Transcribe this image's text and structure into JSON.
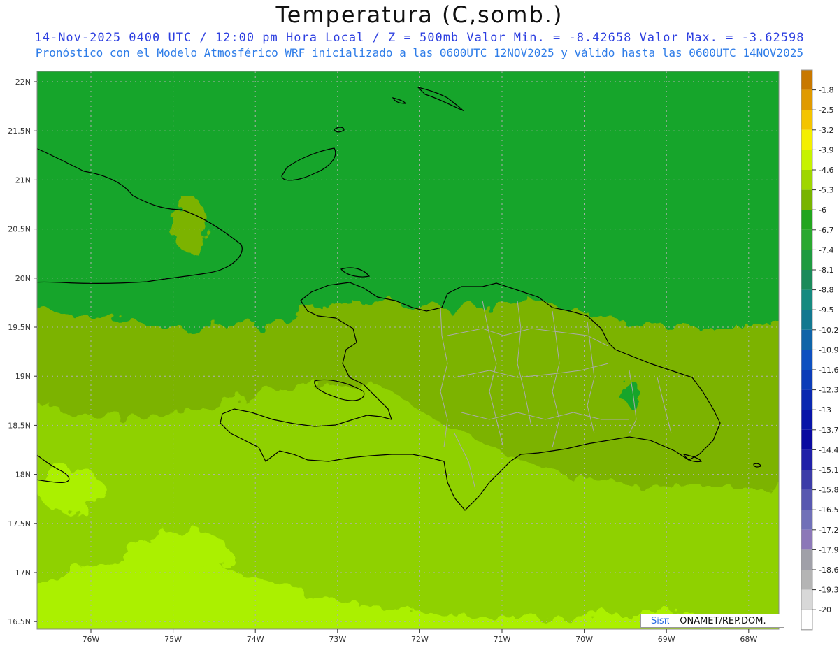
{
  "header": {
    "title": "Temperatura (C,somb.)",
    "subtitle1": "14-Nov-2025 0400 UTC / 12:00 pm Hora Local / Z = 500mb  Valor Min. = -8.42658  Valor Max. = -3.62598",
    "subtitle2": "Pronóstico con el Modelo Atmosférico WRF inicializado a las 0600UTC_12NOV2025 y válido hasta las  0600UTC_14NOV2025"
  },
  "credit": {
    "logo": "Sisπ",
    "text": " – ONAMET/REP.DOM."
  },
  "axes": {
    "lat_labels": [
      "22N",
      "21.5N",
      "21N",
      "20.5N",
      "20N",
      "19.5N",
      "19N",
      "18.5N",
      "18N",
      "17.5N",
      "17N",
      "16.5N"
    ],
    "lon_labels": [
      "76W",
      "75W",
      "74W",
      "73W",
      "72W",
      "71W",
      "70W",
      "69W",
      "68W"
    ]
  },
  "colorbar": {
    "labels": [
      "-1.8",
      "-2.5",
      "-3.2",
      "-3.9",
      "-4.6",
      "-5.3",
      "-6",
      "-6.7",
      "-7.4",
      "-8.1",
      "-8.8",
      "-9.5",
      "-10.2",
      "-10.9",
      "-11.6",
      "-12.3",
      "-13",
      "-13.7",
      "-14.4",
      "-15.1",
      "-15.8",
      "-16.5",
      "-17.2",
      "-17.9",
      "-18.6",
      "-19.3",
      "-20"
    ],
    "colors": [
      "#c87800",
      "#e09a00",
      "#f4c400",
      "#f4ef00",
      "#c6f200",
      "#9fd600",
      "#78b400",
      "#22a51e",
      "#2aa830",
      "#1e9a40",
      "#1a8a5a",
      "#168a80",
      "#127890",
      "#0f64a8",
      "#0e50c0",
      "#0c3cb8",
      "#0a28b0",
      "#0814a8",
      "#0a0aa0",
      "#2020a8",
      "#3c3ca8",
      "#5858b0",
      "#7070b8",
      "#8c78b8",
      "#a0a0a8",
      "#b4b4b4",
      "#d8d8d8"
    ]
  },
  "palette": {
    "ocean_north": "#16a52b",
    "mid_band": "#7cb300",
    "south_band": "#8fd100",
    "far_south": "#abf000",
    "coast": "#000000",
    "province_borders": "#aaaaaa",
    "grid": "#b0b0b0"
  }
}
